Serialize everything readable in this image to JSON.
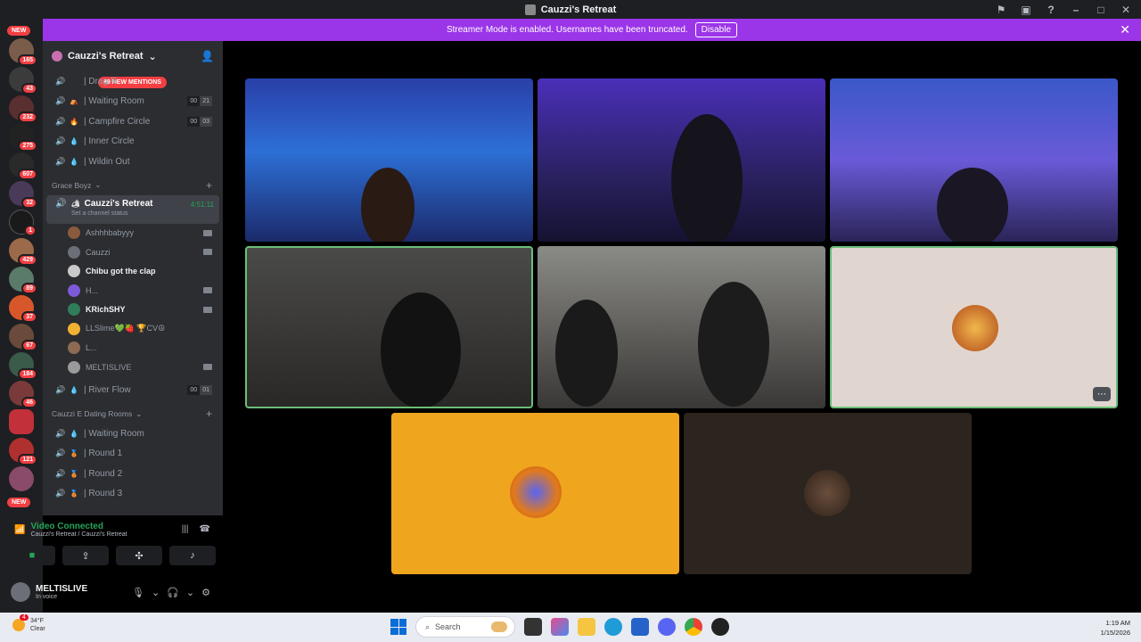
{
  "window": {
    "title": "Cauzzi's Retreat"
  },
  "banner": {
    "text": "Streamer Mode is enabled. Usernames have been truncated.",
    "button": "Disable"
  },
  "server_rail": {
    "new_top": "NEW",
    "new_bottom": "NEW",
    "badges": [
      "165",
      "43",
      "232",
      "275",
      "607",
      "32",
      "1",
      "429",
      "89",
      "37",
      "67",
      "184",
      "46",
      "121"
    ]
  },
  "guild": {
    "name": "Cauzzi's Retreat",
    "mentions": "89 NEW MENTIONS"
  },
  "channels_top": [
    {
      "name": "| Drag R",
      "emoji": ""
    },
    {
      "name": "| Waiting Room",
      "emoji": "⛺",
      "c1": "00",
      "c2": "21"
    },
    {
      "name": "| Campfire Circle",
      "emoji": "🔥",
      "c1": "00",
      "c2": "03"
    },
    {
      "name": "| Inner Circle",
      "emoji": "💧"
    },
    {
      "name": "| Wildin Out",
      "emoji": "💧"
    }
  ],
  "category1": {
    "name": "Grace Boyz"
  },
  "active_channel": {
    "name": "Cauzzi's Retreat",
    "time": "4:51:11",
    "status": "Set a channel status"
  },
  "voice_users": [
    {
      "name": "Ashhhbabyyy",
      "bright": false,
      "cam": true,
      "color": "#8a5a3c"
    },
    {
      "name": "Cauzzi",
      "bright": false,
      "cam": true,
      "color": "#6d6f78"
    },
    {
      "name": "Chibu got the clap",
      "bright": true,
      "cam": false,
      "color": "#c9c9c9"
    },
    {
      "name": "H...",
      "bright": false,
      "cam": true,
      "color": "#7c5ad9"
    },
    {
      "name": "KRichSHY",
      "bright": true,
      "cam": true,
      "color": "#2f7d5a"
    },
    {
      "name": "LLSlime💚🍓 🏆CV☮",
      "bright": false,
      "cam": false,
      "color": "#f0b232"
    },
    {
      "name": "L...",
      "bright": false,
      "cam": false,
      "color": "#8e6a52"
    },
    {
      "name": "MELTISLIVE",
      "bright": false,
      "cam": true,
      "color": "#9a9a9a"
    }
  ],
  "channel_after": {
    "name": "| River Flow",
    "emoji": "💧",
    "c1": "00",
    "c2": "01"
  },
  "category2": {
    "name": "Cauzzi E Dating Rooms"
  },
  "channels_bottom": [
    {
      "name": "| Waiting Room",
      "emoji": "💧"
    },
    {
      "name": "| Round 1",
      "emoji": "🥉"
    },
    {
      "name": "| Round 2",
      "emoji": "🥉"
    },
    {
      "name": "| Round 3",
      "emoji": "🥉"
    }
  ],
  "voice_panel": {
    "status": "Video Connected",
    "sub": "Cauzzi's Retreat / Cauzzi's Retreat"
  },
  "user": {
    "name": "MELTISLIVE",
    "status": "In voice"
  },
  "taskbar": {
    "temp": "34°F",
    "cond": "Clear",
    "weather_badge": "4",
    "search": "Search",
    "time": "1:19 AM",
    "date": "1/15/2026"
  }
}
